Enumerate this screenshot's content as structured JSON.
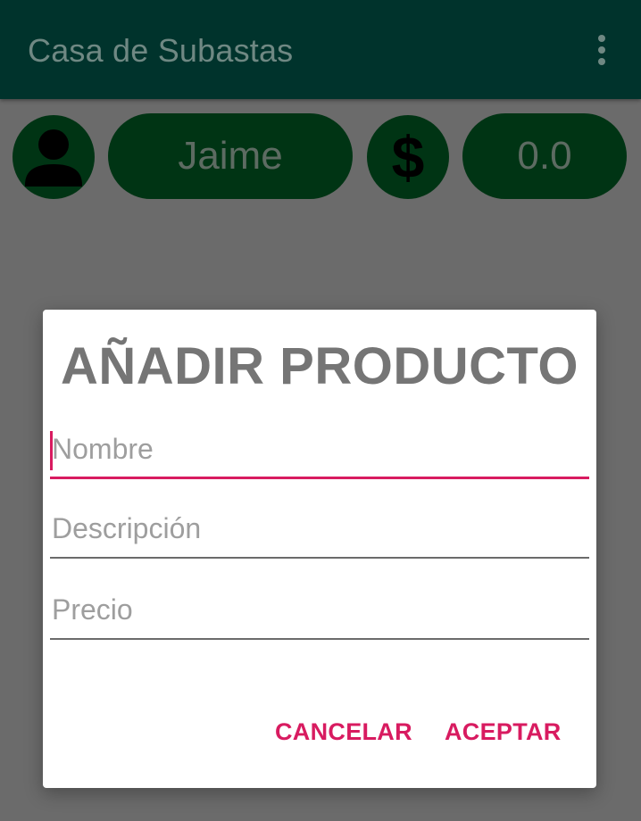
{
  "app": {
    "title": "Casa de Subastas",
    "overflow_menu_icon": "more-vert-icon",
    "colors": {
      "appbar": "#00332c",
      "chips": "#003414",
      "accent": "#d81b60",
      "scrim": "#6b6b6b"
    }
  },
  "user_bar": {
    "avatar_icon": "person-icon",
    "user_name": "Jaime",
    "currency_icon": "dollar-icon",
    "currency_symbol": "$",
    "balance": "0.0"
  },
  "dialog": {
    "title": "AÑADIR PRODUCTO",
    "fields": [
      {
        "placeholder": "Nombre",
        "value": "",
        "focused": true
      },
      {
        "placeholder": "Descripción",
        "value": ""
      },
      {
        "placeholder": "Precio",
        "value": ""
      }
    ],
    "buttons": {
      "cancel": "CANCELAR",
      "accept": "ACEPTAR"
    }
  }
}
